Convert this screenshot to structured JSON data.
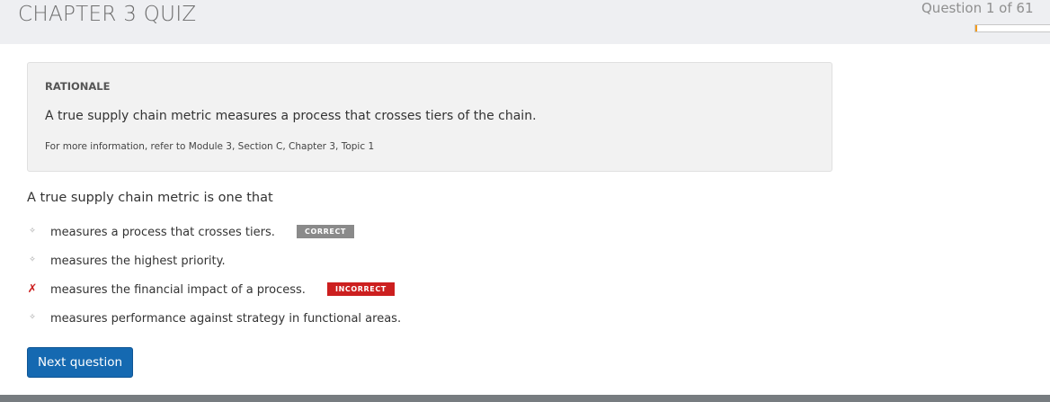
{
  "header": {
    "title": "CHAPTER 3 QUIZ",
    "counter": "Question 1 of 61",
    "progress_fraction": 0.016,
    "accent_color": "#f39c1e"
  },
  "rationale": {
    "heading": "RATIONALE",
    "text": "A true supply chain metric measures a process that crosses tiers of the chain.",
    "reference": "For more information, refer to Module 3, Section C, Chapter 3, Topic 1"
  },
  "question": {
    "prompt": "A true supply chain metric is one that",
    "answers": [
      {
        "marker": "✧",
        "text": "measures a process that crosses tiers.",
        "badge": "CORRECT",
        "status": "correct"
      },
      {
        "marker": "✧",
        "text": "measures the highest priority.",
        "badge": "",
        "status": "none"
      },
      {
        "marker": "✗",
        "text": "measures the financial impact of a process.",
        "badge": "INCORRECT",
        "status": "incorrect"
      },
      {
        "marker": "✧",
        "text": "measures performance against strategy in functional areas.",
        "badge": "",
        "status": "none"
      }
    ]
  },
  "actions": {
    "next_label": "Next question",
    "button_color": "#1569b1"
  }
}
